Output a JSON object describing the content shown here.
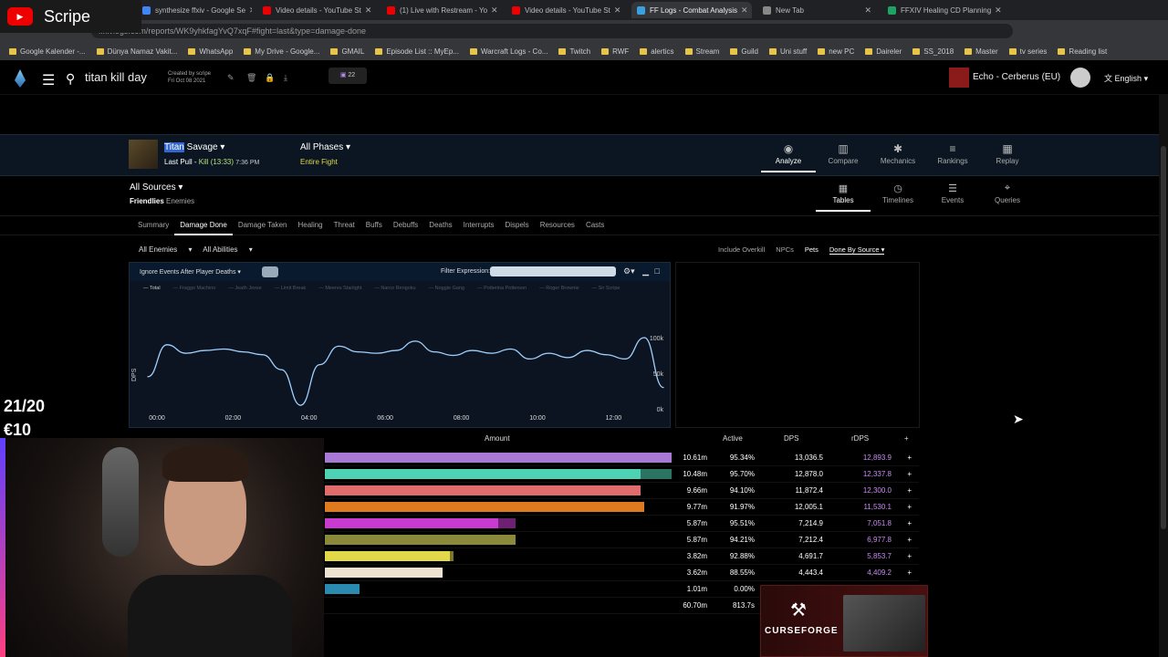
{
  "browser": {
    "tabs": [
      {
        "label": "synthesize ffxiv - Google Se",
        "color": "#4285f4"
      },
      {
        "label": "Video details - YouTube St",
        "color": "#e00"
      },
      {
        "label": "(1) Live with Restream - Yo",
        "color": "#e00"
      },
      {
        "label": "Video details - YouTube St",
        "color": "#e00"
      },
      {
        "label": "FF Logs - Combat Analysis",
        "color": "#3aa0e0"
      },
      {
        "label": "New Tab",
        "color": "#888"
      },
      {
        "label": "FFXIV Healing CD Planning",
        "color": "#1ea362"
      }
    ],
    "url": "ffxivlogs.com/reports/WK9yhkfagYvQ7xqF#fight=last&type=damage-done",
    "bookmarks": [
      "Google Kalender -...",
      "Dünya Namaz Vakit...",
      "WhatsApp",
      "My Drive - Google...",
      "GMAIL",
      "Episode List :: MyEp...",
      "Warcraft Logs - Co...",
      "Twitch",
      "RWF",
      "alertics",
      "Stream",
      "Guild",
      "Uni stuff",
      "new PC",
      "Daireler",
      "SS_2018",
      "Master",
      "tv series",
      "Reading list"
    ]
  },
  "stream": {
    "channel": "Scripe",
    "goal": "21/20",
    "donation": "€10",
    "ad_text": "CURSEFORGE"
  },
  "header": {
    "report_title": "titan kill day",
    "created_by": "Created by scripe",
    "created_date": "Fri Oct 08 2021",
    "comments_count": "22",
    "server": "Echo - Cerberus (EU)",
    "language": "English"
  },
  "fight": {
    "boss_highlight": "Titan",
    "boss_rest": " Savage",
    "pull": "Last Pull - ",
    "kill": "Kill (13:33)",
    "time": "7:36 PM",
    "phases": "All Phases",
    "phases_sub": "Entire Fight"
  },
  "nav": [
    "Analyze",
    "Compare",
    "Mechanics",
    "Rankings",
    "Replay"
  ],
  "views": [
    "Tables",
    "Timelines",
    "Events",
    "Queries"
  ],
  "sources": {
    "title": "All Sources",
    "friendlies": "Friendlies",
    "enemies": "Enemies"
  },
  "metric_tabs": [
    "Summary",
    "Damage Done",
    "Damage Taken",
    "Healing",
    "Threat",
    "Buffs",
    "Debuffs",
    "Deaths",
    "Interrupts",
    "Dispels",
    "Resources",
    "Casts"
  ],
  "filters": {
    "enemies": "All Enemies",
    "abilities": "All Abilities"
  },
  "options": {
    "overkill": "Include Overkill",
    "npcs": "NPCs",
    "pets": "Pets",
    "done_by": "Done By Source"
  },
  "graph": {
    "ignore": "Ignore Events After Player Deaths",
    "filter_label": "Filter Expression:",
    "legend": [
      "Total",
      "Fraggo Machino",
      "Jeath Jesse",
      "Limit Break",
      "Meeres Starlight",
      "Narco Rengoku",
      "Noggie Gang",
      "Potterina Potterson",
      "Roger Brownie",
      "Sir Scripe"
    ],
    "ylabel": "DPS",
    "yticks": [
      "100k",
      "50k",
      "0k"
    ],
    "xticks": [
      "00:00",
      "02:00",
      "04:00",
      "06:00",
      "08:00",
      "10:00",
      "12:00"
    ]
  },
  "chart_data": {
    "type": "line",
    "ylabel": "DPS",
    "x": [
      "00:00",
      "00:30",
      "01:00",
      "01:30",
      "02:00",
      "02:30",
      "03:00",
      "03:30",
      "04:00",
      "04:30",
      "05:00",
      "05:30",
      "06:00",
      "06:30",
      "07:00",
      "07:30",
      "08:00",
      "08:30",
      "09:00",
      "09:30",
      "10:00",
      "10:30",
      "11:00",
      "11:30",
      "12:00",
      "12:30",
      "13:00",
      "13:33"
    ],
    "series": [
      {
        "name": "Total",
        "values": [
          45000,
          90000,
          78000,
          82000,
          84000,
          80000,
          76000,
          55000,
          5000,
          62000,
          88000,
          80000,
          78000,
          82000,
          95000,
          80000,
          75000,
          82000,
          78000,
          84000,
          70000,
          78000,
          72000,
          82000,
          76000,
          70000,
          100000,
          30000
        ]
      }
    ],
    "ylim": [
      0,
      100000
    ]
  },
  "table": {
    "headers": [
      "Amount",
      "Active",
      "DPS",
      "rDPS",
      "+"
    ],
    "rows": [
      {
        "amount": "10.61m",
        "active": "95.34%",
        "dps": "13,036.5",
        "rdps": "12,893.9",
        "color": "#a87ad6",
        "frac": 1.0,
        "frac2": 0
      },
      {
        "amount": "10.48m",
        "active": "95.70%",
        "dps": "12,878.0",
        "rdps": "12,337.8",
        "color": "#4ed2b4",
        "frac": 0.91,
        "frac2": 0.09
      },
      {
        "amount": "9.66m",
        "active": "94.10%",
        "dps": "11,872.4",
        "rdps": "12,300.0",
        "color": "#e06c6c",
        "frac": 0.91,
        "frac2": 0
      },
      {
        "amount": "9.77m",
        "active": "91.97%",
        "dps": "12,005.1",
        "rdps": "11,530.1",
        "color": "#e07a1e",
        "frac": 0.92,
        "frac2": 0
      },
      {
        "amount": "5.87m",
        "active": "95.51%",
        "dps": "7,214.9",
        "rdps": "7,051.8",
        "color": "#c83ad0",
        "frac": 0.5,
        "frac2": 0.05
      },
      {
        "amount": "5.87m",
        "active": "94.21%",
        "dps": "7,212.4",
        "rdps": "6,977.8",
        "color": "#8a8a3a",
        "frac": 0.55,
        "frac2": 0
      },
      {
        "amount": "3.82m",
        "active": "92.88%",
        "dps": "4,691.7",
        "rdps": "5,853.7",
        "color": "#e2d94a",
        "frac": 0.36,
        "frac2": 0.01
      },
      {
        "amount": "3.62m",
        "active": "88.55%",
        "dps": "4,443.4",
        "rdps": "4,409.2",
        "color": "#f0e2d0",
        "frac": 0.34,
        "frac2": 0
      },
      {
        "amount": "1.01m",
        "active": "0.00%",
        "dps": "",
        "rdps": "",
        "color": "#2a8ab0",
        "frac": 0.1,
        "frac2": 0
      },
      {
        "amount": "60.70m",
        "active": "813.7s",
        "dps": "",
        "rdps": "",
        "color": "",
        "frac": 0,
        "frac2": 0
      }
    ]
  }
}
